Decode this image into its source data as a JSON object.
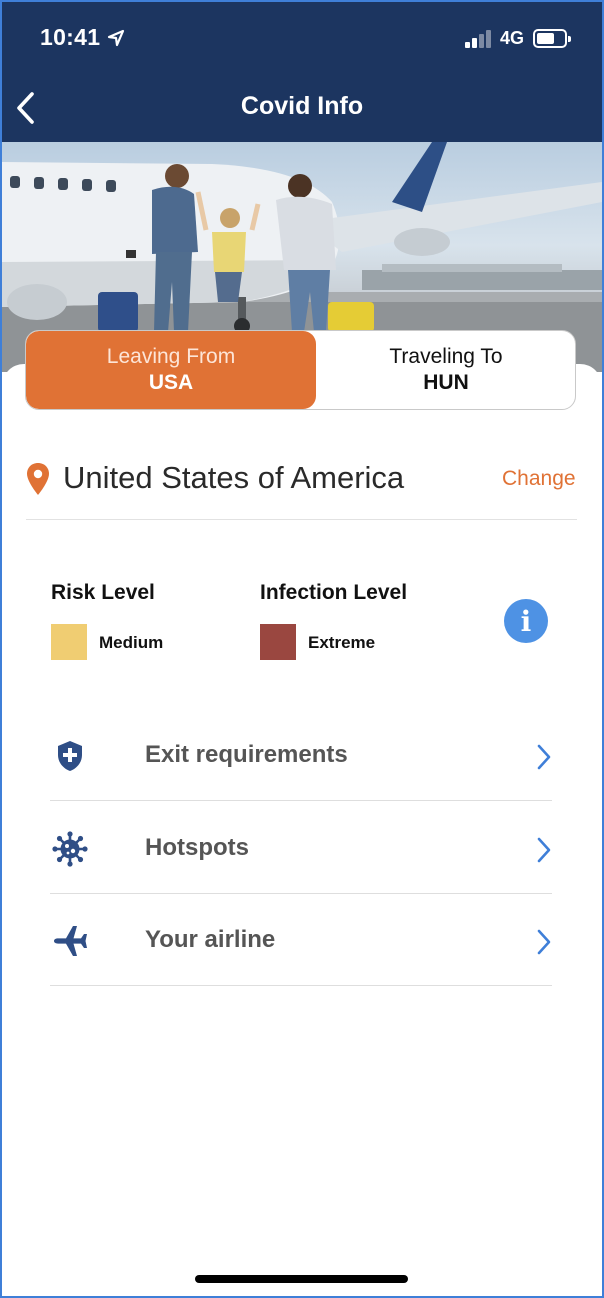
{
  "status_bar": {
    "time": "10:41",
    "network": "4G"
  },
  "nav": {
    "title": "Covid Info"
  },
  "segments": [
    {
      "label": "Leaving From",
      "code": "USA",
      "active": true
    },
    {
      "label": "Traveling To",
      "code": "HUN",
      "active": false
    }
  ],
  "location": {
    "country": "United States of America",
    "change_label": "Change"
  },
  "levels": {
    "risk": {
      "heading": "Risk Level",
      "value": "Medium",
      "color": "#f0cd72"
    },
    "infection": {
      "heading": "Infection Level",
      "value": "Extreme",
      "color": "#9a4740"
    }
  },
  "menu": [
    {
      "label": "Exit requirements",
      "icon": "shield-plus-icon"
    },
    {
      "label": "Hotspots",
      "icon": "virus-icon"
    },
    {
      "label": "Your airline",
      "icon": "airplane-icon"
    }
  ],
  "colors": {
    "navy": "#1c3560",
    "accent": "#e07235",
    "link_blue": "#3f7fd8",
    "icon_navy": "#2f4e86"
  }
}
